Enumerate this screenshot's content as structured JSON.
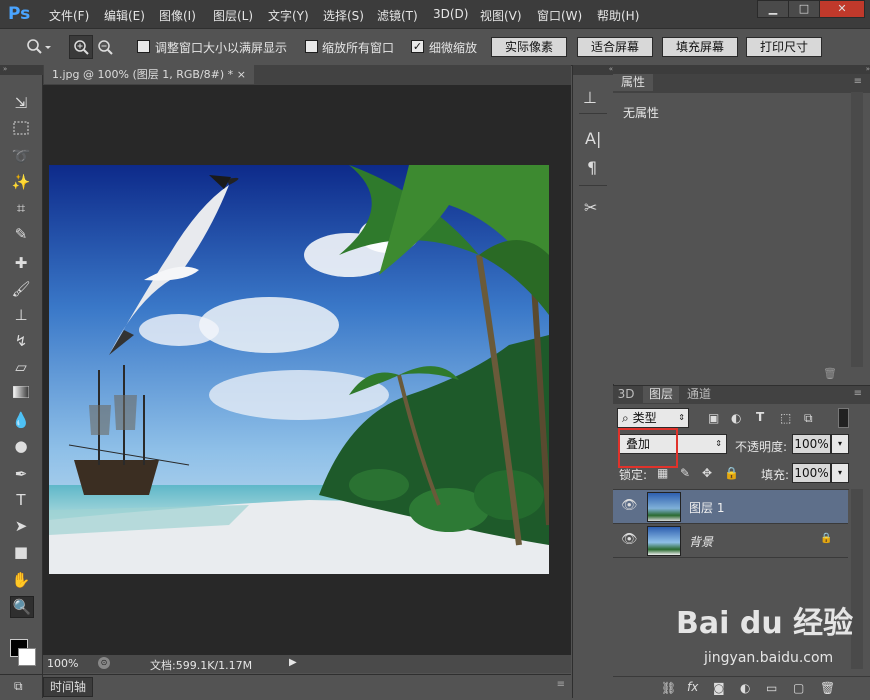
{
  "app": {
    "logo": "Ps"
  },
  "menu": [
    "文件(F)",
    "编辑(E)",
    "图像(I)",
    "图层(L)",
    "文字(Y)",
    "选择(S)",
    "滤镜(T)",
    "3D(D)",
    "视图(V)",
    "窗口(W)",
    "帮助(H)"
  ],
  "window_controls": {
    "minimize": "▁",
    "maximize": "□",
    "close": "✕"
  },
  "options": {
    "resize_windows": "调整窗口大小以满屏显示",
    "zoom_all": "缩放所有窗口",
    "scrubby_zoom": "细微缩放",
    "actual_pixels": "实际像素",
    "fit_screen": "适合屏幕",
    "fill_screen": "填充屏幕",
    "print_size": "打印尺寸"
  },
  "document": {
    "tab_title": "1.jpg @ 100% (图层 1, RGB/8#) *",
    "tab_close": "×",
    "zoom": "100%",
    "doc_info": "文档:599.1K/1.17M"
  },
  "timeline": {
    "label": "时间轴"
  },
  "properties": {
    "tab": "属性",
    "content": "无属性"
  },
  "layers_panel": {
    "tabs": [
      "3D",
      "图层",
      "通道"
    ],
    "filter_kind": "类型",
    "blend_mode": "叠加",
    "opacity_label": "不透明度:",
    "opacity_value": "100%",
    "lock_label": "锁定:",
    "fill_label": "填充:",
    "fill_value": "100%",
    "layers": [
      {
        "name": "图层 1",
        "selected": true
      },
      {
        "name": "背景",
        "selected": false,
        "locked": true
      }
    ]
  },
  "watermark": {
    "brand": "Bai du 经验",
    "url": "jingyan.baidu.com"
  },
  "colors": {
    "selected_layer": "#5e6f8a",
    "highlight_box": "#e0322b",
    "ps_blue": "#4aa4ff"
  }
}
